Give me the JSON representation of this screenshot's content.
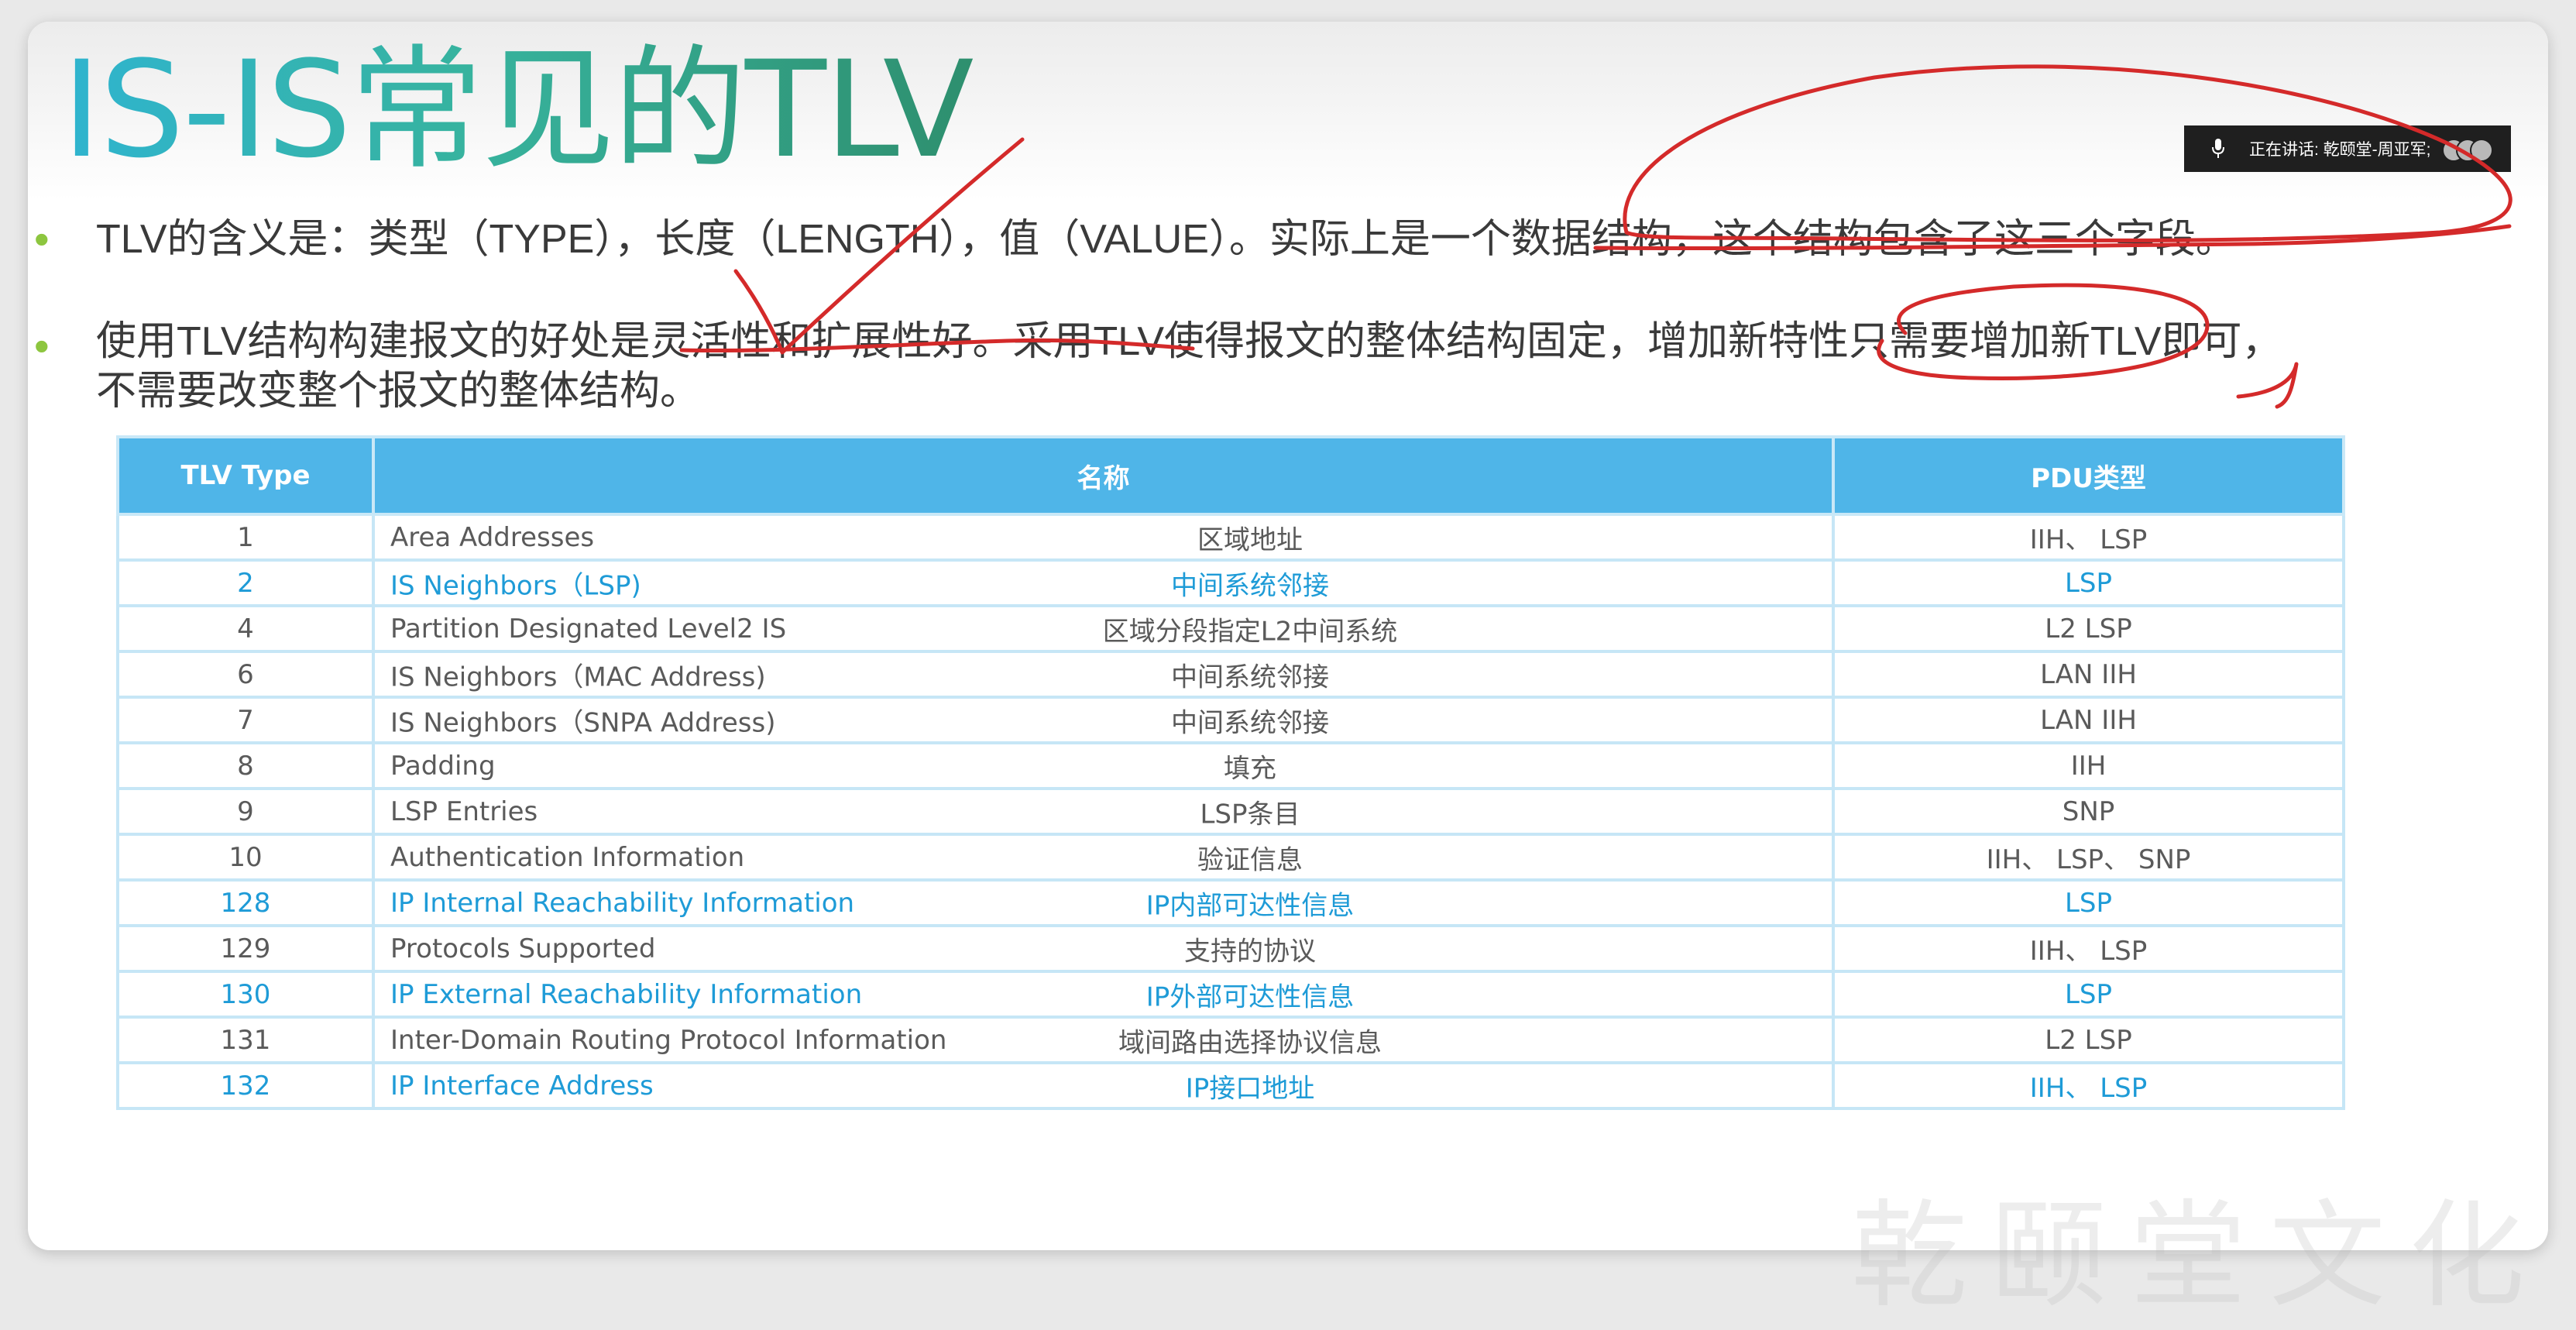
{
  "slide": {
    "title": "IS-IS常见的TLV",
    "bullets": [
      {
        "lines": [
          "TLV的含义是：类型（TYPE），长度（LENGTH），值（VALUE）。实际上是一个数据结构，这个结构包含了这三个字段。"
        ]
      },
      {
        "lines": [
          "使用TLV结构构建报文的好处是灵活性和扩展性好。采用TLV使得报文的整体结构固定，增加新特性只需要增加新TLV即可，",
          "不需要改变整个报文的整体结构。"
        ]
      }
    ]
  },
  "speaker_bar": {
    "label": "正在讲话: 乾颐堂-周亚军;",
    "icon": "microphone-icon"
  },
  "table": {
    "headers": [
      "TLV Type",
      "名称",
      "PDU类型"
    ],
    "rows": [
      {
        "type": "1",
        "name_en": "Area Addresses",
        "name_zh": "区域地址",
        "pdu": "IIH、 LSP",
        "highlight": false
      },
      {
        "type": "2",
        "name_en": "IS Neighbors（LSP)",
        "name_zh": "中间系统邻接",
        "pdu": "LSP",
        "highlight": true
      },
      {
        "type": "4",
        "name_en": "Partition Designated Level2 IS",
        "name_zh": "区域分段指定L2中间系统",
        "pdu": "L2 LSP",
        "highlight": false
      },
      {
        "type": "6",
        "name_en": "IS Neighbors（MAC Address)",
        "name_zh": "中间系统邻接",
        "pdu": "LAN IIH",
        "highlight": false
      },
      {
        "type": "7",
        "name_en": "IS Neighbors（SNPA Address)",
        "name_zh": "中间系统邻接",
        "pdu": "LAN IIH",
        "highlight": false
      },
      {
        "type": "8",
        "name_en": "Padding",
        "name_zh": "填充",
        "pdu": "IIH",
        "highlight": false
      },
      {
        "type": "9",
        "name_en": "LSP Entries",
        "name_zh": "LSP条目",
        "pdu": "SNP",
        "highlight": false
      },
      {
        "type": "10",
        "name_en": "Authentication Information",
        "name_zh": "验证信息",
        "pdu": "IIH、 LSP、 SNP",
        "highlight": false
      },
      {
        "type": "128",
        "name_en": "IP Internal Reachability Information",
        "name_zh": "IP内部可达性信息",
        "pdu": "LSP",
        "highlight": true
      },
      {
        "type": "129",
        "name_en": "Protocols Supported",
        "name_zh": "支持的协议",
        "pdu": "IIH、 LSP",
        "highlight": false
      },
      {
        "type": "130",
        "name_en": "IP External Reachability Information",
        "name_zh": "IP外部可达性信息",
        "pdu": "LSP",
        "highlight": true
      },
      {
        "type": "131",
        "name_en": "Inter-Domain Routing Protocol Information",
        "name_zh": "域间路由选择协议信息",
        "pdu": "L2 LSP",
        "highlight": false
      },
      {
        "type": "132",
        "name_en": "IP Interface Address",
        "name_zh": "IP接口地址",
        "pdu": "IIH、 LSP",
        "highlight": true
      }
    ]
  },
  "watermark": "乾颐堂文化",
  "colors": {
    "accent_bullet": "#8dc63f",
    "table_header": "#4fb5e8",
    "highlight_row_text": "#1e9bd7",
    "annotation_ink": "#d42a2a"
  }
}
